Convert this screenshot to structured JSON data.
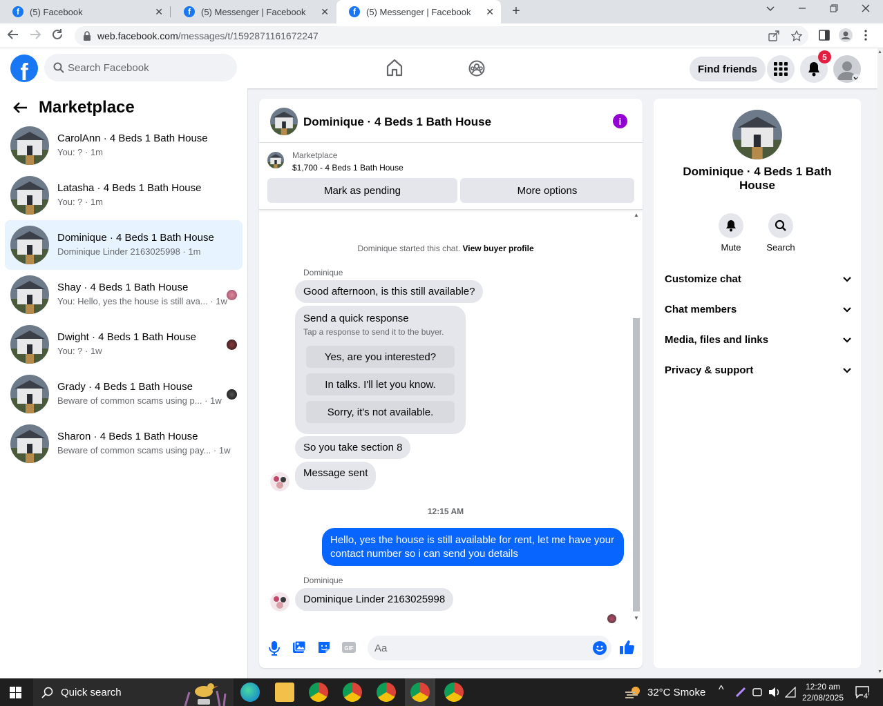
{
  "browser": {
    "tabs": [
      {
        "title": "(5) Facebook",
        "close": "✕"
      },
      {
        "title": "(5) Messenger | Facebook",
        "close": "✕"
      },
      {
        "title": "(5) Messenger | Facebook",
        "close": "✕"
      }
    ],
    "url_host": "web.facebook.com",
    "url_path": "/messages/t/1592871161672247"
  },
  "fb": {
    "search_placeholder": "Search Facebook",
    "find_friends": "Find friends",
    "notif_count": "5"
  },
  "sidebar": {
    "title": "Marketplace",
    "conversations": [
      {
        "name": "CarolAnn · 4 Beds 1 Bath House",
        "snippet": "You: ? · 1m"
      },
      {
        "name": "Latasha · 4 Beds 1 Bath House",
        "snippet": "You: ? · 1m"
      },
      {
        "name": "Dominique · 4 Beds 1 Bath House",
        "snippet": "Dominique Linder 2163025998 · 1m"
      },
      {
        "name": "Shay · 4 Beds 1 Bath House",
        "snippet": "You: Hello, yes the house is still ava... · 1w"
      },
      {
        "name": "Dwight · 4 Beds 1 Bath House",
        "snippet": "You: ? · 1w"
      },
      {
        "name": "Grady · 4 Beds 1 Bath House",
        "snippet": "Beware of common scams using p... · 1w"
      },
      {
        "name": "Sharon · 4 Beds 1 Bath House",
        "snippet": "Beware of common scams using pay... · 1w"
      }
    ]
  },
  "chat": {
    "title": "Dominique · 4 Beds 1 Bath House",
    "listing_source": "Marketplace",
    "listing": "$1,700 - 4 Beds 1 Bath House",
    "mark_pending": "Mark as pending",
    "more_options": "More options",
    "started": "Dominique started this chat.",
    "view_profile": "View buyer profile",
    "sender_name": "Dominique",
    "msg1": "Good afternoon, is this still available?",
    "quick_title": "Send a quick response",
    "quick_sub": "Tap a response to send it to the buyer.",
    "quick": [
      "Yes, are you interested?",
      "In talks. I'll let you know.",
      "Sorry, it's not available."
    ],
    "msg2": "So you take section 8",
    "msg3": "Message sent",
    "time": "12:15 AM",
    "mine": "Hello, yes the house is still available for rent, let me have your contact number so i can send you  details",
    "msg4": "Dominique Linder 2163025998",
    "compose_placeholder": "Aa"
  },
  "details": {
    "name": "Dominique · 4 Beds 1 Bath House",
    "mute": "Mute",
    "search": "Search",
    "sections": [
      "Customize chat",
      "Chat members",
      "Media, files and links",
      "Privacy & support"
    ]
  },
  "taskbar": {
    "search": "Quick search",
    "weather": "32°C  Smoke",
    "time": "12:20 am",
    "date": "22/08/2025",
    "notif": "4"
  },
  "colors": {
    "fb_blue": "#1877f2",
    "bubble_blue": "#0866ff",
    "accent_purple": "#9400d3"
  }
}
